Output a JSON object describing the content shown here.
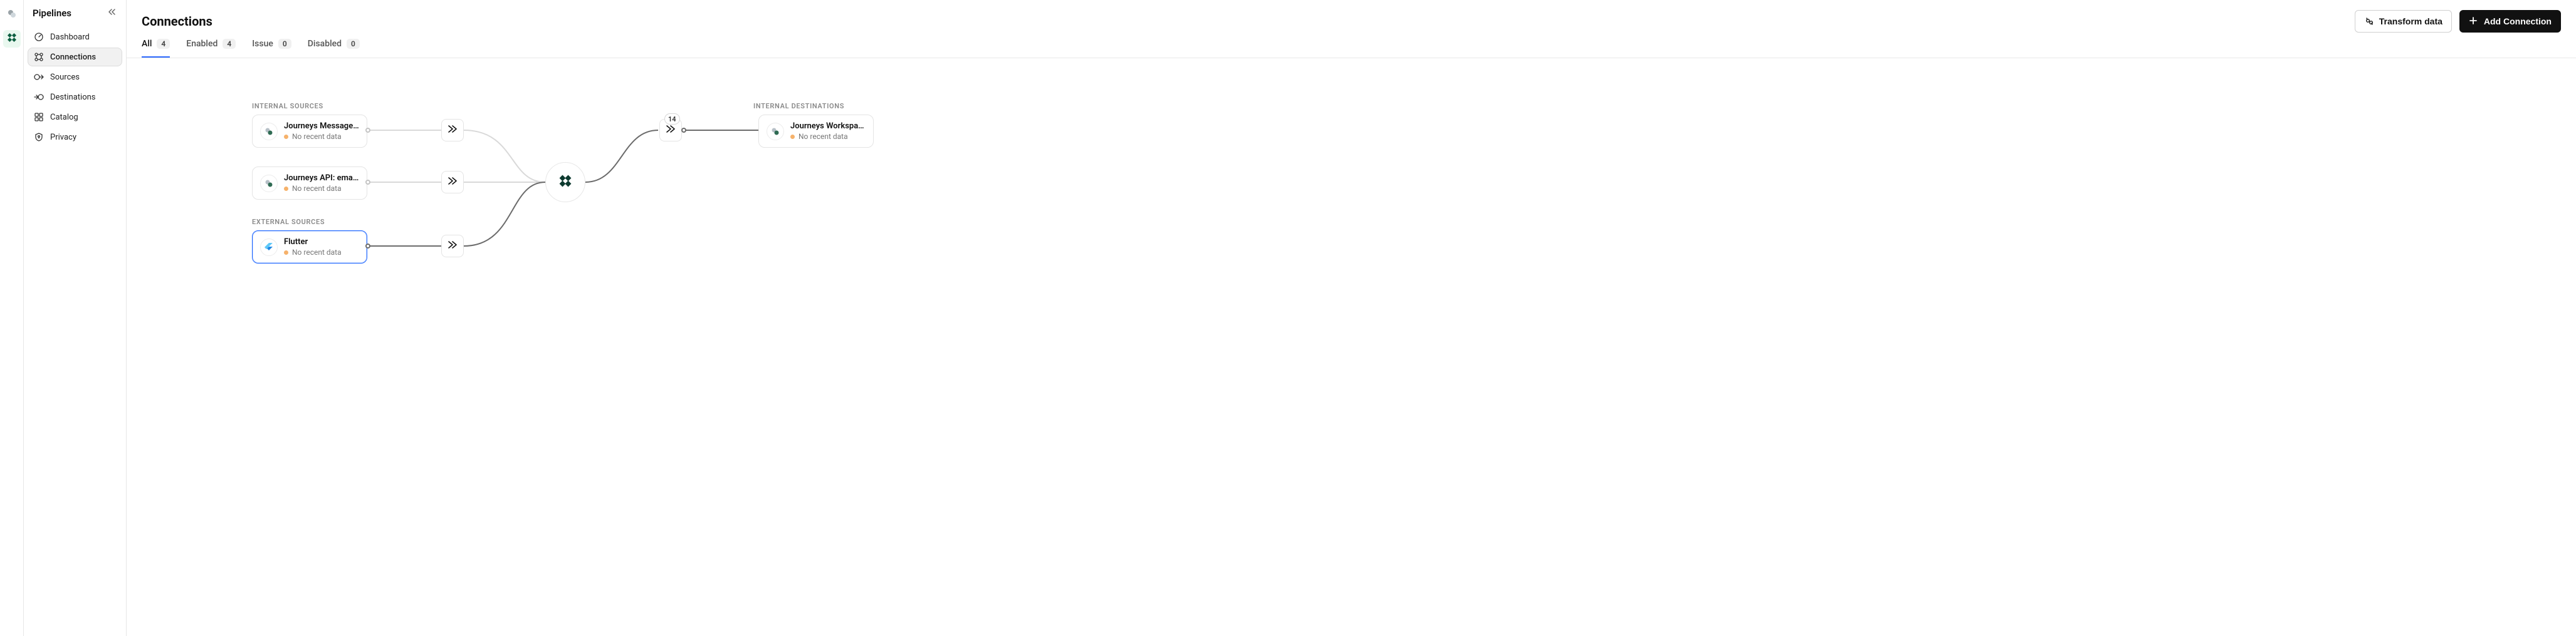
{
  "sidebar": {
    "title": "Pipelines",
    "items": [
      {
        "label": "Dashboard"
      },
      {
        "label": "Connections"
      },
      {
        "label": "Sources"
      },
      {
        "label": "Destinations"
      },
      {
        "label": "Catalog"
      },
      {
        "label": "Privacy"
      }
    ]
  },
  "page": {
    "title": "Connections",
    "transform_btn": "Transform data",
    "add_btn": "Add Connection"
  },
  "tabs": [
    {
      "label": "All",
      "count": "4"
    },
    {
      "label": "Enabled",
      "count": "4"
    },
    {
      "label": "Issue",
      "count": "0"
    },
    {
      "label": "Disabled",
      "count": "0"
    }
  ],
  "sections": {
    "internal_sources": "Internal Sources",
    "external_sources": "External Sources",
    "internal_destinations": "Internal Destinations"
  },
  "nodes": {
    "s1": {
      "title": "Journeys Message …",
      "status": "No recent data"
    },
    "s2": {
      "title": "Journeys API: email …",
      "status": "No recent data"
    },
    "s3": {
      "title": "Flutter",
      "status": "No recent data"
    },
    "d1": {
      "title": "Journeys Workspace",
      "status": "No recent data"
    }
  },
  "badge": {
    "hub_count": "14"
  },
  "colors": {
    "accent": "#2b68ff",
    "wire_light": "#d9d9d9",
    "wire_dark": "#6b6b6b",
    "status_dot": "#f6b26b"
  }
}
